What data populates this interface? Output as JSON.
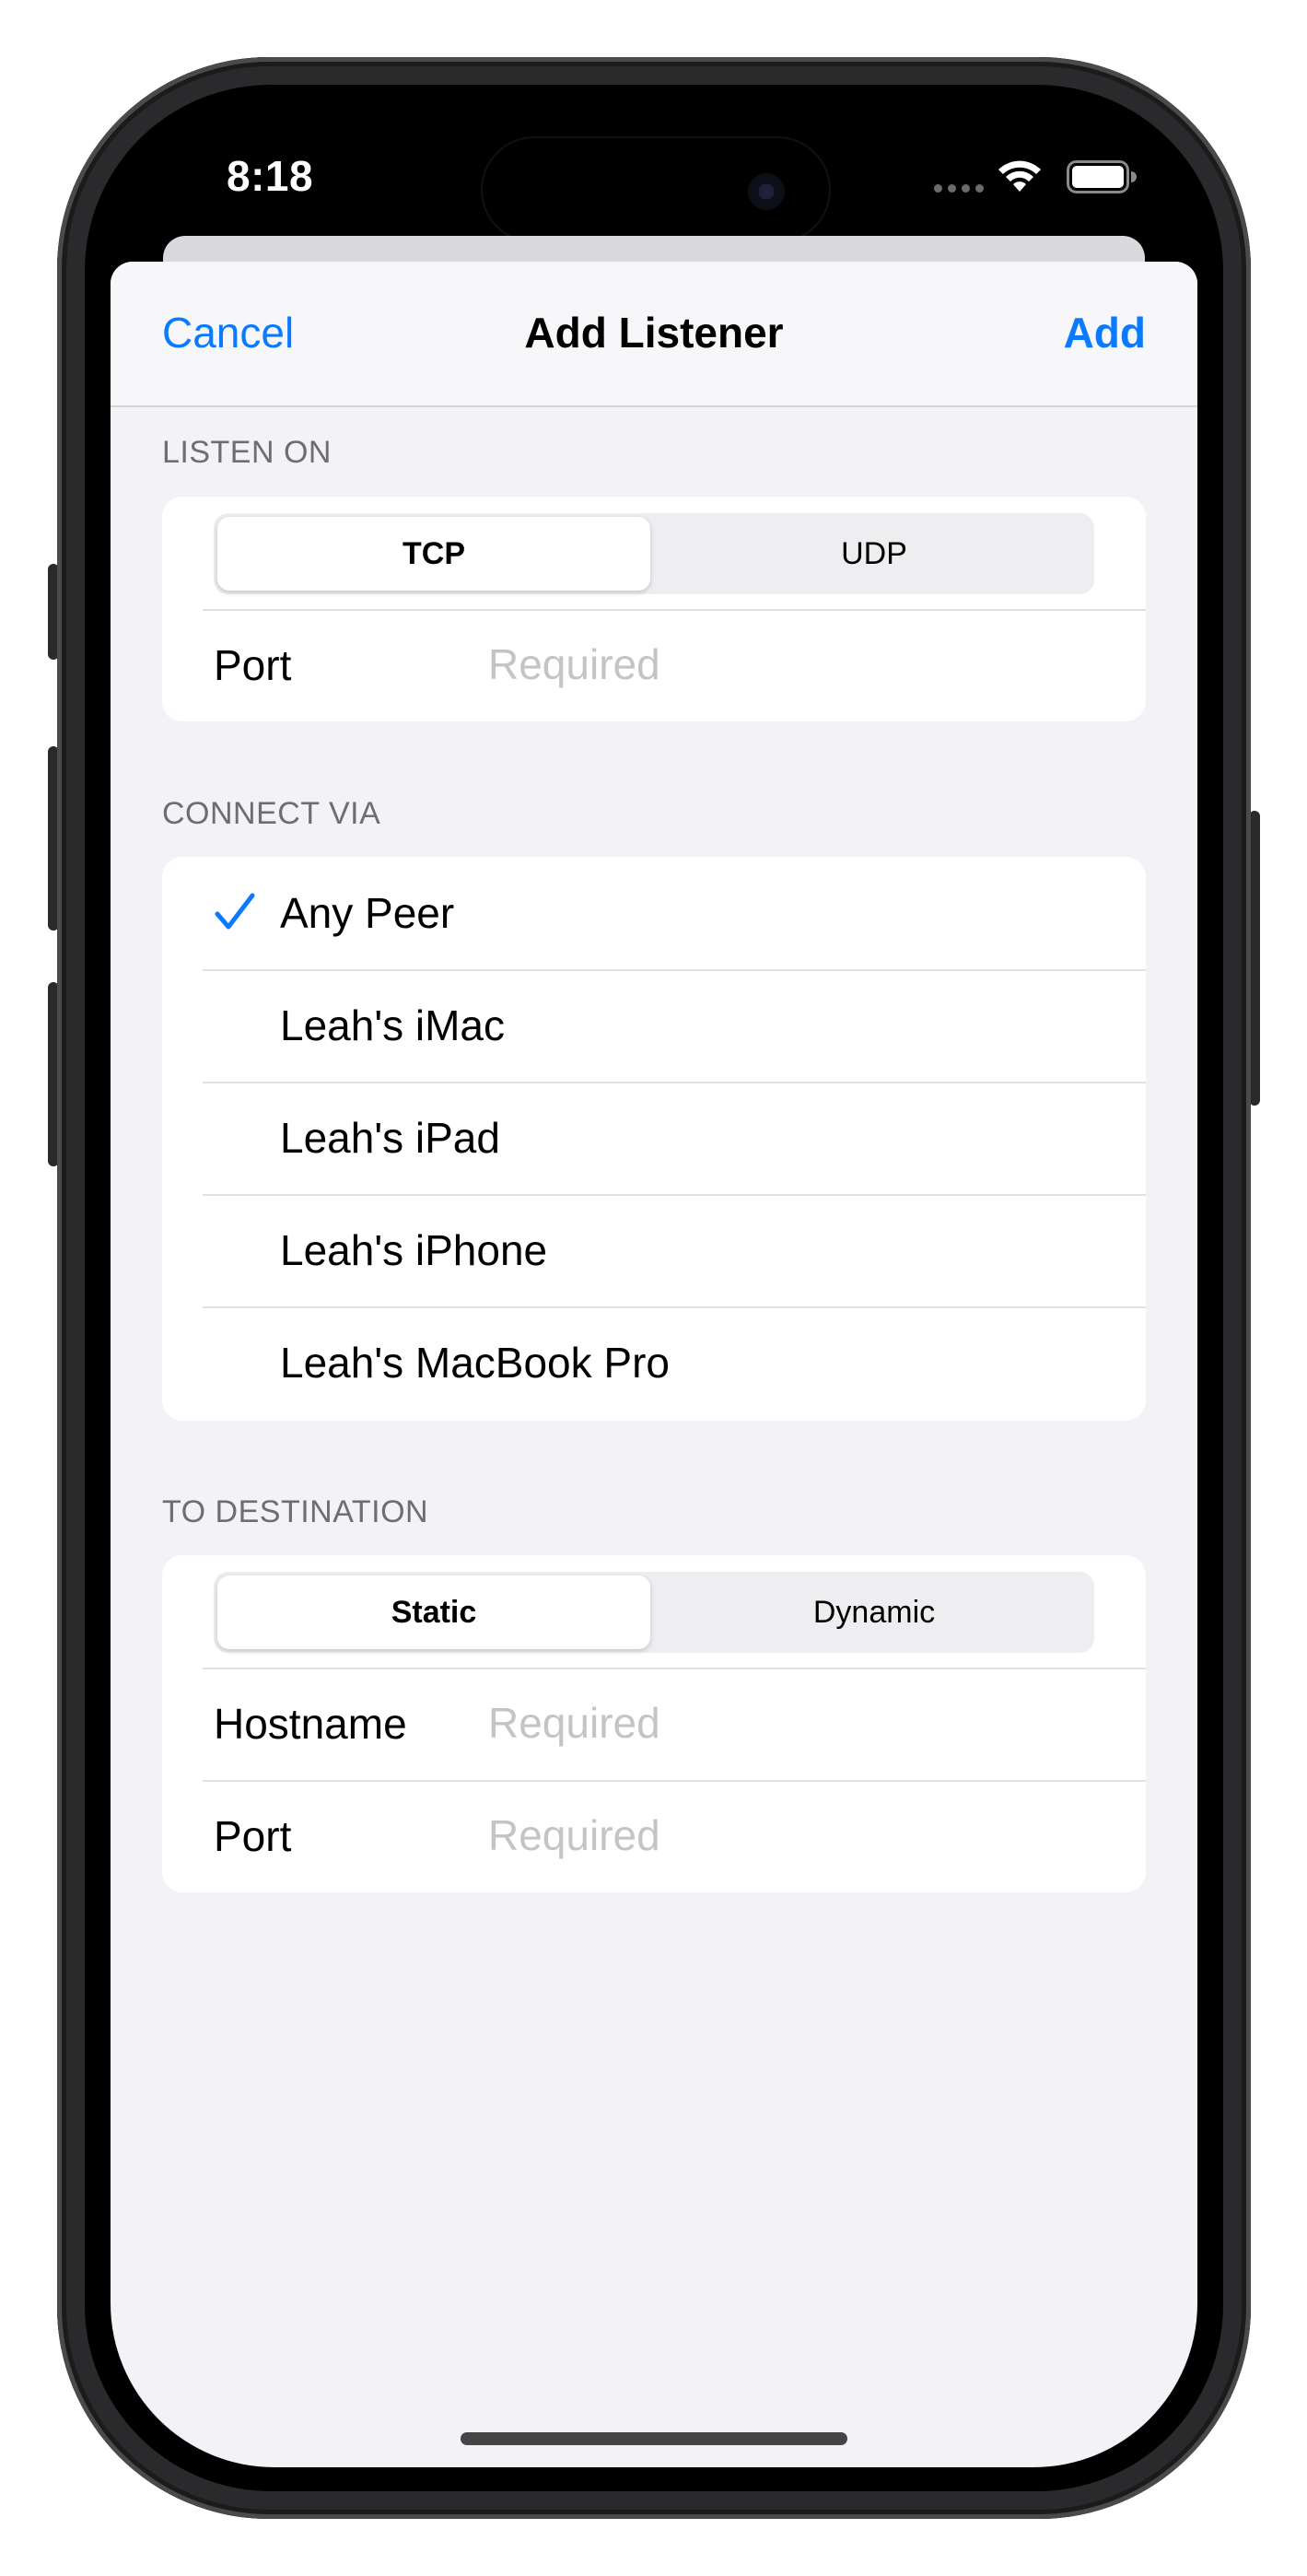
{
  "status_bar": {
    "time": "8:18"
  },
  "nav": {
    "cancel_label": "Cancel",
    "title": "Add Listener",
    "add_label": "Add"
  },
  "listen_on": {
    "header": "LISTEN ON",
    "protocol_options": [
      "TCP",
      "UDP"
    ],
    "selected_protocol": "TCP",
    "port_label": "Port",
    "port_placeholder": "Required",
    "port_value": ""
  },
  "connect_via": {
    "header": "CONNECT VIA",
    "peers": [
      "Any Peer",
      "Leah's iMac",
      "Leah's iPad",
      "Leah's iPhone",
      "Leah's MacBook Pro"
    ],
    "selected_peer": "Any Peer"
  },
  "to_destination": {
    "header": "TO DESTINATION",
    "mode_options": [
      "Static",
      "Dynamic"
    ],
    "selected_mode": "Static",
    "hostname_label": "Hostname",
    "hostname_placeholder": "Required",
    "port_label": "Port",
    "port_placeholder": "Required"
  },
  "colors": {
    "accent": "#0a7aff",
    "background": "#f2f2f7",
    "placeholder": "#c4c4c7",
    "section_header": "#6d6d72"
  },
  "icons": {
    "checkmark": "checkmark-icon",
    "wifi": "wifi-icon",
    "battery": "battery-icon"
  }
}
